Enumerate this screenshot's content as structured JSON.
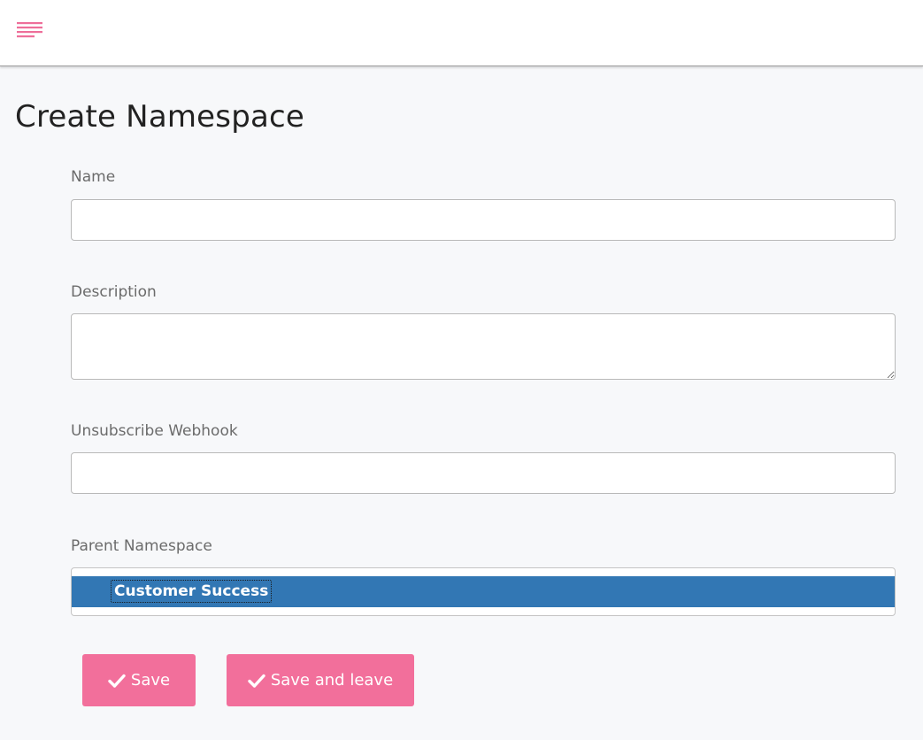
{
  "colors": {
    "accent": "#f26f9b",
    "selection": "#3277b4",
    "background": "#f7f8fa"
  },
  "header": {
    "menu_icon": "hamburger-menu-icon"
  },
  "page": {
    "title": "Create Namespace"
  },
  "form": {
    "name_label": "Name",
    "name_value": "",
    "description_label": "Description",
    "description_value": "",
    "webhook_label": "Unsubscribe Webhook",
    "webhook_value": "",
    "parent_label": "Parent Namespace",
    "parent_selected": "Customer Success"
  },
  "actions": {
    "save_label": "Save",
    "save_leave_label": "Save and leave",
    "check_icon": "check-icon"
  }
}
